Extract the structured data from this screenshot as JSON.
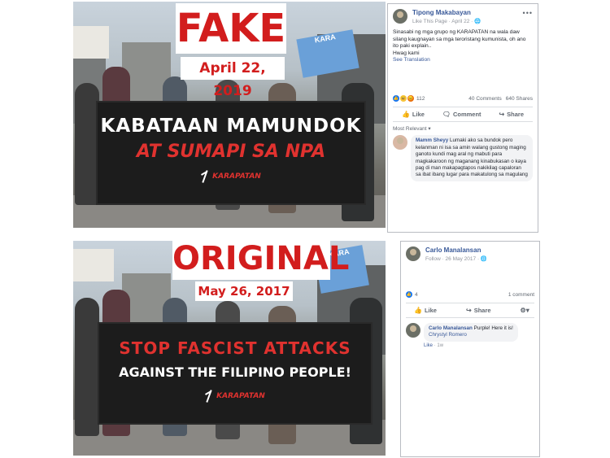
{
  "labels": {
    "fake_title": "FAKE",
    "fake_date": "April 22, 2019",
    "original_title": "ORIGINAL",
    "original_date": "May 26, 2017"
  },
  "banners": {
    "fake": {
      "line1": "KABATAAN MAMUNDOK",
      "line2": "AT SUMAPI SA NPA",
      "logo_text": "KARAPATAN"
    },
    "original": {
      "line1": "STOP FASCIST ATTACKS",
      "line2": "AGAINST THE FILIPINO PEOPLE!",
      "logo_text": "KARAPATAN"
    }
  },
  "colors": {
    "stamp_red": "#d21d1d",
    "banner_red": "#e0322f",
    "fb_blue": "#385898"
  },
  "fake_post": {
    "page_name": "Tipong Makabayan",
    "meta": "Like This Page · April 22 · 🌐",
    "body": "Sinasabi ng mga grupo ng KARAPATAN na wala daw silang kaugnayan sa mga teroristang kumunista, oh ano ito paki explain..\nHwag kami",
    "see_translation": "See Translation",
    "reaction_count": "112",
    "comments_count": "40 Comments",
    "shares_count": "640 Shares",
    "actions": {
      "like": "Like",
      "comment": "Comment",
      "share": "Share"
    },
    "sort_label": "Most Relevant ▾",
    "comment": {
      "author": "Mamm Sheyy",
      "text": "Lumaki ako sa bundok pero kelanman ni isa sa amin walang gustong maging ganoto kundi mag aral ng mabuti para magkakaroon ng maganang kinabukasan o kaya pag di man makapagtapos nakikilag capaloran sa ibat ibang lugar para makatulong sa magulang"
    }
  },
  "original_post": {
    "page_name": "Carlo Manalansan",
    "meta": "Follow · 26 May 2017 · 🌐",
    "reaction_count": "4",
    "comments_count": "1 comment",
    "actions": {
      "like": "Like",
      "share": "Share"
    },
    "comment": {
      "author": "Carlo Manalansan",
      "text": "Purple! Here it is!",
      "tag": "Chrystyl Romero",
      "like_label": "Like",
      "time": "1w"
    }
  }
}
